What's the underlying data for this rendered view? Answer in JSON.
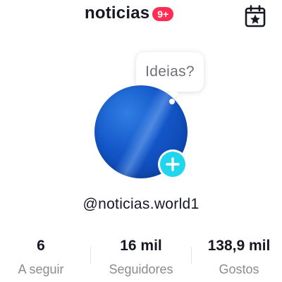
{
  "header": {
    "title": "noticias",
    "badge": "9+",
    "calendar_icon": "calendar-star-icon"
  },
  "profile": {
    "bubble_text": "Ideias?",
    "avatar_colors": [
      "#2f7fe3",
      "#1356c8",
      "#0a3d9c"
    ],
    "add_icon": "plus-icon",
    "add_color": "#20d5ec",
    "username": "@noticias.world1"
  },
  "stats": [
    {
      "value": "6",
      "label": "A seguir"
    },
    {
      "value": "16 mil",
      "label": "Seguidores"
    },
    {
      "value": "138,9 mil",
      "label": "Gostos"
    }
  ],
  "colors": {
    "badge_bg": "#ff2c55",
    "text_primary": "#161823",
    "text_secondary": "#8a8b91"
  }
}
